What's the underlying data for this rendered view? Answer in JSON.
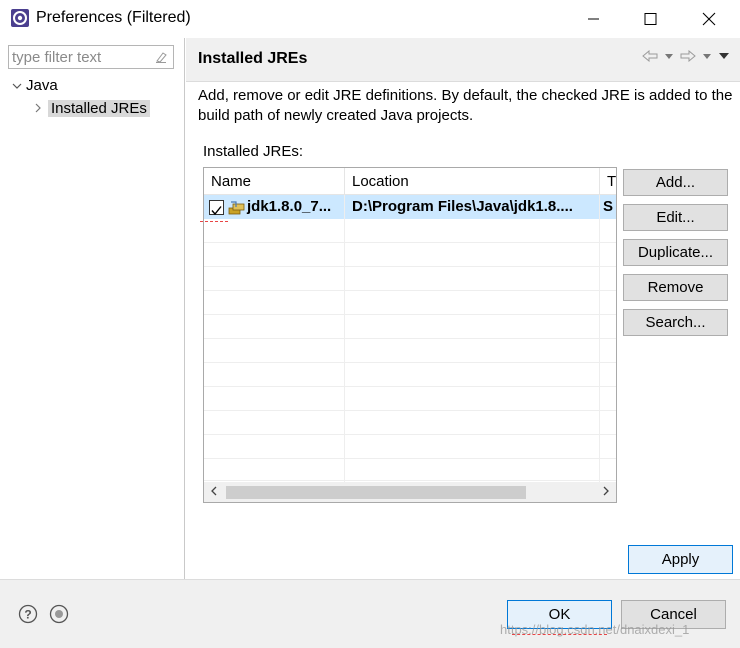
{
  "window": {
    "title": "Preferences (Filtered)",
    "icon": "eclipse-preferences-icon"
  },
  "filter": {
    "placeholder": "type filter text"
  },
  "tree": {
    "items": [
      {
        "label": "Java",
        "expanded": true
      },
      {
        "label": "Installed JREs",
        "selected": true
      }
    ]
  },
  "page": {
    "title": "Installed JREs",
    "description": "Add, remove or edit JRE definitions. By default, the checked JRE is added to the build path of newly created Java projects.",
    "table_label": "Installed JREs:"
  },
  "table": {
    "columns": [
      "Name",
      "Location",
      "T"
    ],
    "rows": [
      {
        "checked": true,
        "name": "jdk1.8.0_7...",
        "location": "D:\\Program Files\\Java\\jdk1.8....",
        "type": "S"
      }
    ]
  },
  "buttons": {
    "add": "Add...",
    "edit": "Edit...",
    "duplicate": "Duplicate...",
    "remove": "Remove",
    "search": "Search...",
    "apply": "Apply",
    "ok": "OK",
    "cancel": "Cancel"
  },
  "watermark": "https://blog.csdn.net/dnaixdexi_1",
  "colors": {
    "selection": "#cce8ff",
    "focus_border": "#0078d7",
    "annotation": "#e84545"
  }
}
